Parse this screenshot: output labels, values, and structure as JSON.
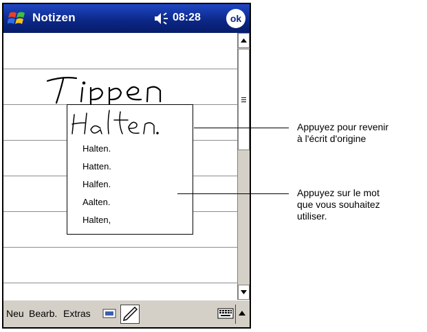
{
  "title_bar": {
    "app_title": "Notizen",
    "time": "08:28",
    "ok_label": "ok",
    "start_icon": "windows-flag-icon",
    "volume_icon": "speaker-icon"
  },
  "note": {
    "handwritten_word": "Tippen",
    "selected_ink_word": "Halten."
  },
  "suggestions": [
    "Halten.",
    "Hatten.",
    "Halfen.",
    "Aalten.",
    "Halten,"
  ],
  "menu_bar": {
    "items": [
      "Neu",
      "Bearb.",
      "Extras"
    ],
    "icons": [
      "recorder-icon",
      "pen-icon",
      "keyboard-icon",
      "input-menu-arrow-icon"
    ]
  },
  "callouts": {
    "revert": [
      "Appuyez pour revenir",
      "à l'écrit d'origine"
    ],
    "choose": [
      "Appuyez sur le mot",
      "que vous souhaitez",
      "utiliser."
    ]
  }
}
